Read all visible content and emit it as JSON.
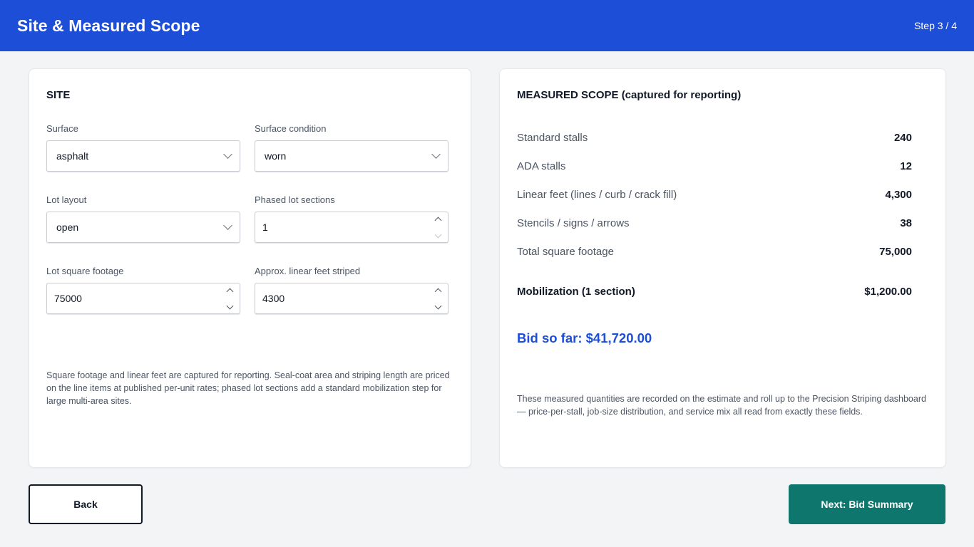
{
  "header": {
    "title": "Site & Measured Scope",
    "step": "Step 3 / 4"
  },
  "site": {
    "heading": "SITE",
    "fields": {
      "surface": {
        "label": "Surface",
        "value": "asphalt"
      },
      "condition": {
        "label": "Surface condition",
        "value": "worn"
      },
      "layout": {
        "label": "Lot layout",
        "value": "open"
      },
      "phased": {
        "label": "Phased lot sections",
        "value": "1"
      },
      "sqft": {
        "label": "Lot square footage",
        "value": "75000"
      },
      "linear": {
        "label": "Approx. linear feet striped",
        "value": "4300"
      }
    },
    "note": "Square footage and linear feet are captured for reporting. Seal-coat area and striping length are priced on the line items at published per-unit rates; phased lot sections add a standard mobilization step for large multi-area sites."
  },
  "scope": {
    "heading": "MEASURED SCOPE (captured for reporting)",
    "rows": [
      {
        "label": "Standard stalls",
        "value": "240"
      },
      {
        "label": "ADA stalls",
        "value": "12"
      },
      {
        "label": "Linear feet (lines / curb / crack fill)",
        "value": "4,300"
      },
      {
        "label": "Stencils / signs / arrows",
        "value": "38"
      },
      {
        "label": "Total square footage",
        "value": "75,000"
      }
    ],
    "mobilization": {
      "label": "Mobilization (1 section)",
      "value": "$1,200.00"
    },
    "bid": "Bid so far: $41,720.00",
    "note": "These measured quantities are recorded on the estimate and roll up to the Precision Striping dashboard — price-per-stall, job-size distribution, and service mix all read from exactly these fields."
  },
  "buttons": {
    "back": "Back",
    "next": "Next: Bid Summary"
  },
  "colors": {
    "header": "#1d4ed8",
    "accent": "#1d4ed8",
    "next_button": "#0f766e"
  }
}
